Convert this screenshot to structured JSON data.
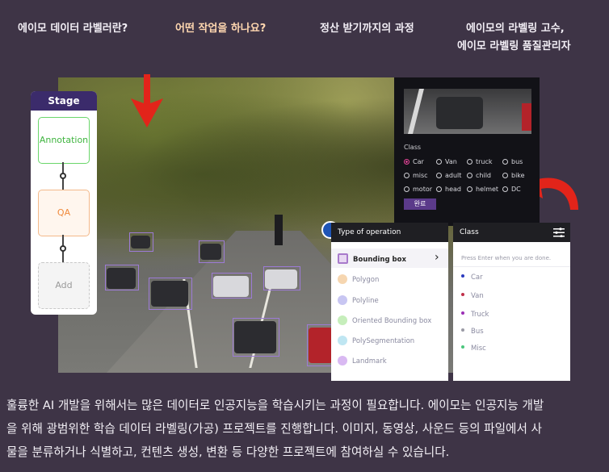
{
  "nav": {
    "items": [
      {
        "label": "에이모 데이터 라벨러란?"
      },
      {
        "label": "어떤 작업을 하나요?"
      },
      {
        "label": "정산 받기까지의 과정"
      },
      {
        "label_line1": "에이모의 라벨링 고수,",
        "label_line2": "에이모 라벨링 품질관리자"
      }
    ],
    "active_color": "#ffd7b0"
  },
  "stage": {
    "title": "Stage",
    "items": [
      "Annotation",
      "QA",
      "Add"
    ]
  },
  "annotation": {
    "class_title": "Class",
    "options": [
      "Car",
      "Van",
      "truck",
      "bus",
      "misc",
      "adult",
      "child",
      "bike",
      "motor",
      "head",
      "helmet",
      "DC"
    ],
    "selected": "Car",
    "done_label": "완료"
  },
  "operation_panel": {
    "title": "Type of operation",
    "items": [
      {
        "label": "Bounding box",
        "icon": "square-icon",
        "color": "#e8d8f2"
      },
      {
        "label": "Polygon",
        "icon": "polygon-icon",
        "color": "#f6d6b0"
      },
      {
        "label": "Polyline",
        "icon": "polyline-icon",
        "color": "#c8c6f2"
      },
      {
        "label": "Oriented Bounding box",
        "icon": "oriented-box-icon",
        "color": "#c6eebb"
      },
      {
        "label": "PolySegmentation",
        "icon": "segmentation-icon",
        "color": "#bfe6f2"
      },
      {
        "label": "Landmark",
        "icon": "landmark-icon",
        "color": "#d9b9f2"
      }
    ],
    "chevron": "›"
  },
  "class_panel": {
    "title": "Class",
    "placeholder": "Press Enter when you are done.",
    "items": [
      {
        "label": "Car",
        "color": "#2b3bbf"
      },
      {
        "label": "Van",
        "color": "#c0304a"
      },
      {
        "label": "Truck",
        "color": "#9b2fb5"
      },
      {
        "label": "Bus",
        "color": "#9a9aa5"
      },
      {
        "label": "Misc",
        "color": "#4bc67c"
      }
    ]
  },
  "description": {
    "line1": "훌륭한 AI 개발을 위해서는 많은 데이터로 인공지능을 학습시키는 과정이 필요합니다. 에이모는 인공지능 개발",
    "line2": "을 위해 광범위한 학습 데이터 라벨링(가공) 프로젝트를 진행합니다. 이미지, 동영상, 사운드 등의 파일에서 사",
    "line3": "물을 분류하거나 식별하고, 컨텐츠 생성, 변환 등 다양한 프로젝트에 참여하실 수 있습니다."
  }
}
